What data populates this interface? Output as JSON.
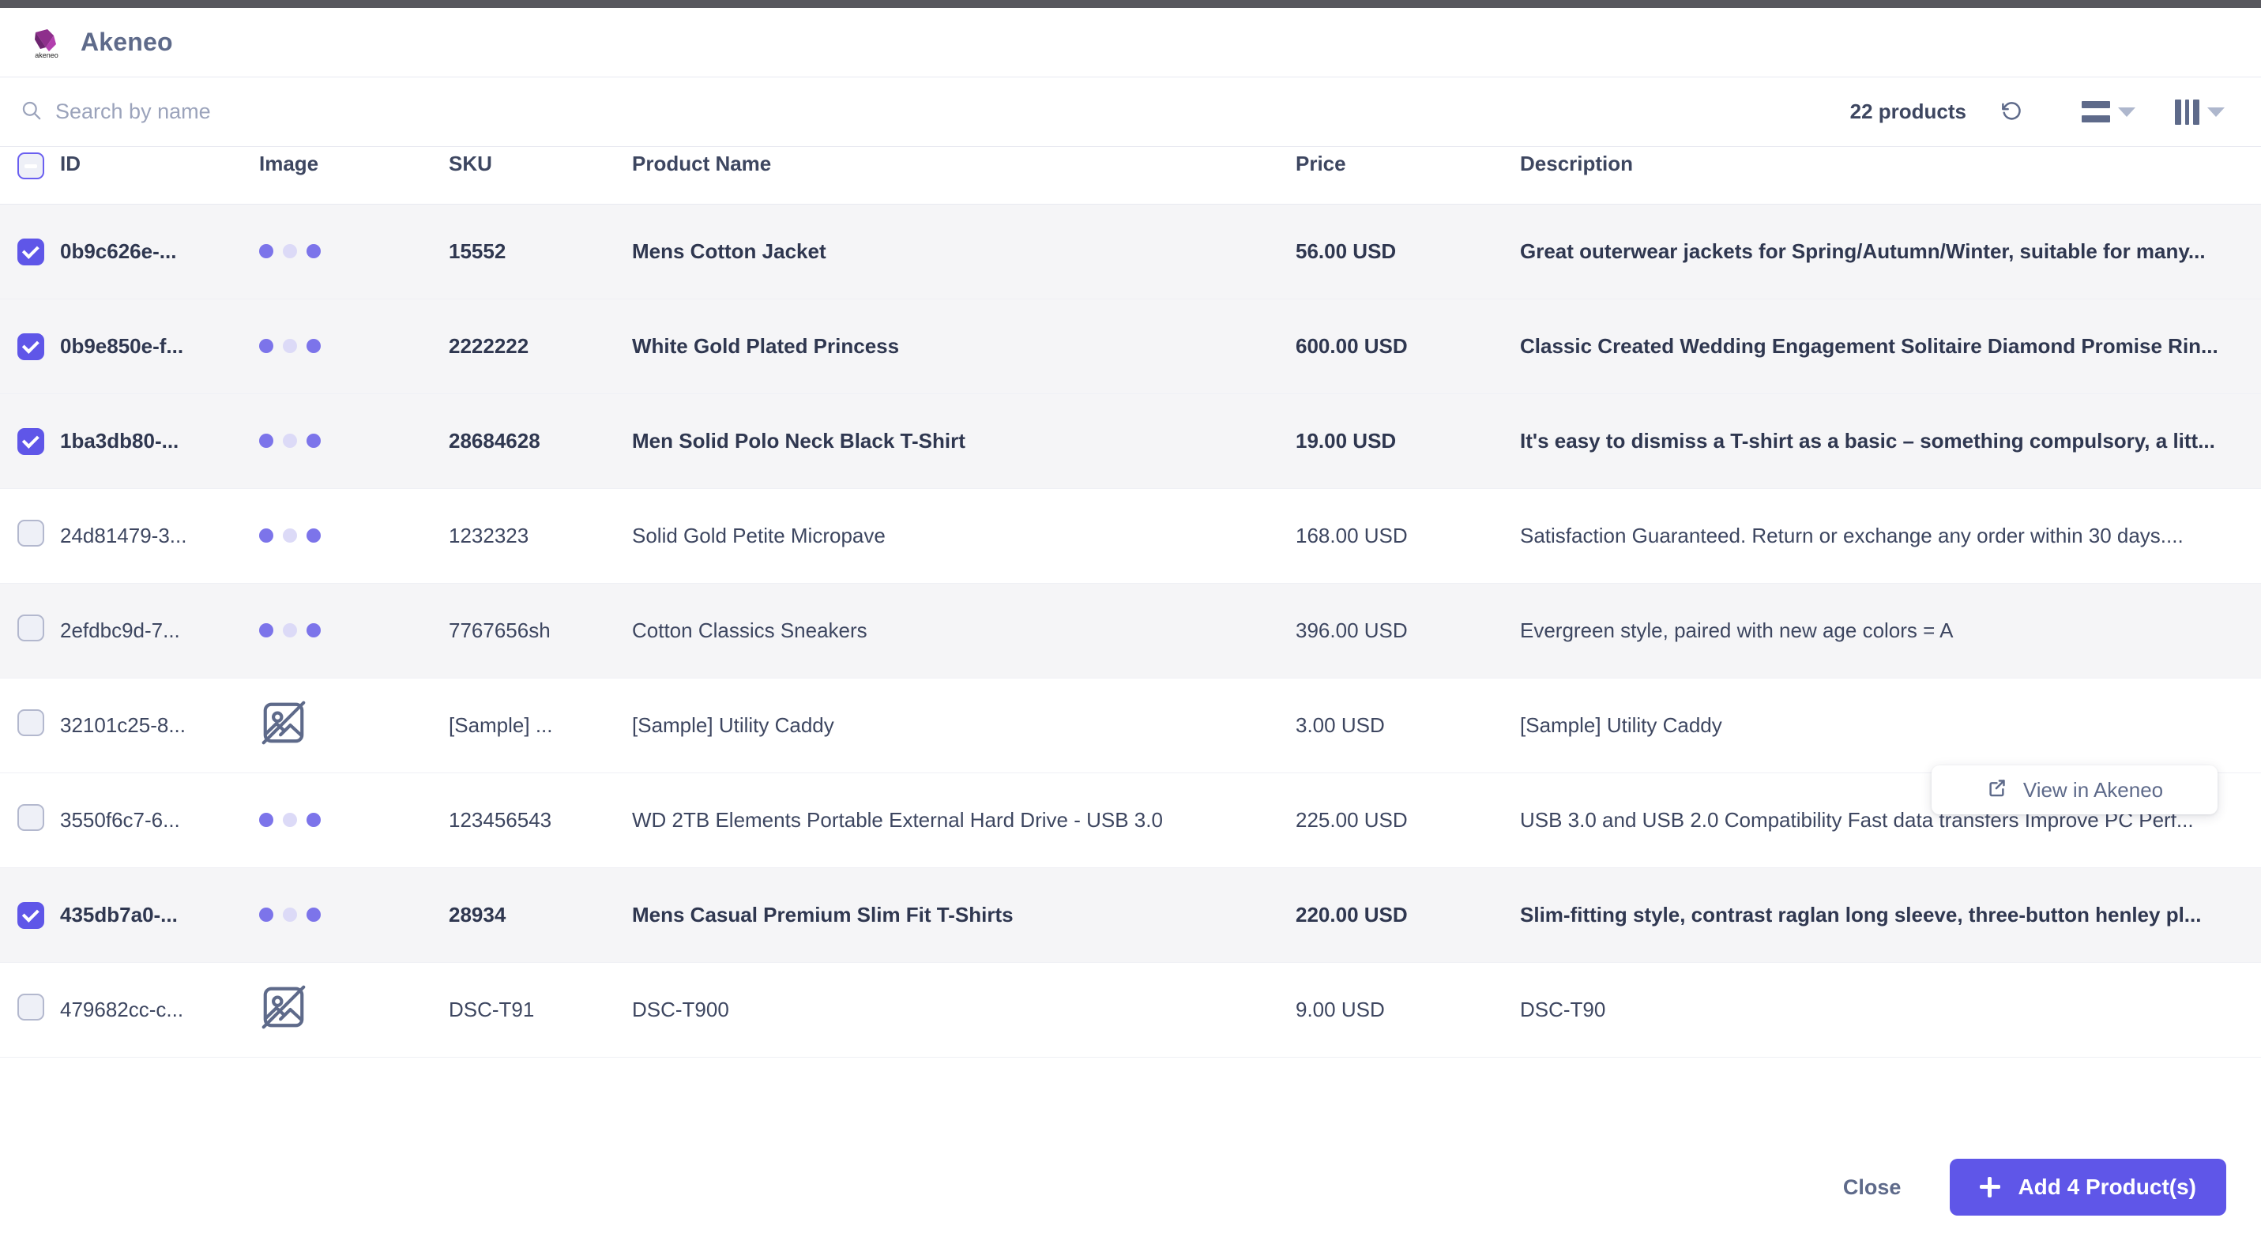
{
  "header": {
    "title": "Akeneo",
    "logo_icon": "akeneo-logo"
  },
  "toolbar": {
    "search_placeholder": "Search by name",
    "search_value": "",
    "search_icon": "search-icon",
    "product_count": "22 products",
    "reset_icon": "undo-reset-icon",
    "rows_icon": "row-density-icon",
    "columns_icon": "column-settings-icon",
    "caret_icon": "chevron-down-icon"
  },
  "table": {
    "columns": [
      "ID",
      "Image",
      "SKU",
      "Product Name",
      "Price",
      "Description"
    ],
    "select_all_state": "indeterminate",
    "rows": [
      {
        "id": "0b9c626e-...",
        "image": "loading-dots",
        "sku": "15552",
        "name": "Mens Cotton Jacket",
        "price": "56.00 USD",
        "description": "Great outerwear jackets for Spring/Autumn/Winter, suitable for many...",
        "selected": true,
        "shaded": true
      },
      {
        "id": "0b9e850e-f...",
        "image": "loading-dots",
        "sku": "2222222",
        "name": "White Gold Plated Princess",
        "price": "600.00 USD",
        "description": "Classic Created Wedding Engagement Solitaire Diamond Promise Rin...",
        "selected": true,
        "shaded": true
      },
      {
        "id": "1ba3db80-...",
        "image": "loading-dots",
        "sku": "28684628",
        "name": "Men Solid Polo Neck Black T-Shirt",
        "price": "19.00 USD",
        "description": "It's easy to dismiss a T-shirt as a basic – something compulsory, a litt...",
        "selected": true,
        "shaded": true
      },
      {
        "id": "24d81479-3...",
        "image": "loading-dots",
        "sku": "1232323",
        "name": "Solid Gold Petite Micropave",
        "price": "168.00 USD",
        "description": "Satisfaction Guaranteed. Return or exchange any order within 30 days....",
        "selected": false,
        "shaded": false
      },
      {
        "id": "2efdbc9d-7...",
        "image": "loading-dots",
        "sku": "7767656sh",
        "name": "Cotton Classics Sneakers",
        "price": "396.00 USD",
        "description": "Evergreen style, paired with new age colors = A",
        "selected": false,
        "shaded": true
      },
      {
        "id": "32101c25-8...",
        "image": "no-image",
        "sku": "[Sample] ...",
        "name": "[Sample] Utility Caddy",
        "price": "3.00 USD",
        "description": "[Sample] Utility Caddy",
        "selected": false,
        "shaded": false
      },
      {
        "id": "3550f6c7-6...",
        "image": "loading-dots",
        "sku": "123456543",
        "name": "WD 2TB Elements Portable External Hard Drive - USB 3.0",
        "price": "225.00 USD",
        "description": "USB 3.0 and USB 2.0 Compatibility Fast data transfers Improve PC Perf...",
        "selected": false,
        "shaded": false
      },
      {
        "id": "435db7a0-...",
        "image": "loading-dots",
        "sku": "28934",
        "name": "Mens Casual Premium Slim Fit T-Shirts",
        "price": "220.00 USD",
        "description": "Slim-fitting style, contrast raglan long sleeve, three-button henley pl...",
        "selected": true,
        "shaded": true
      },
      {
        "id": "479682cc-c...",
        "image": "no-image",
        "sku": "DSC-T91",
        "name": "DSC-T900",
        "price": "9.00 USD",
        "description": "DSC-T90",
        "selected": false,
        "shaded": false
      }
    ]
  },
  "view_in_akeneo": {
    "label": "View in Akeneo",
    "icon": "external-link-icon"
  },
  "footer": {
    "close_label": "Close",
    "add_label": "Add 4 Product(s)",
    "add_icon": "plus-icon"
  },
  "colors": {
    "accent": "#5f56e8",
    "text": "#3d4660",
    "muted": "#5e6a8a",
    "row_shade": "#f5f5f7"
  }
}
